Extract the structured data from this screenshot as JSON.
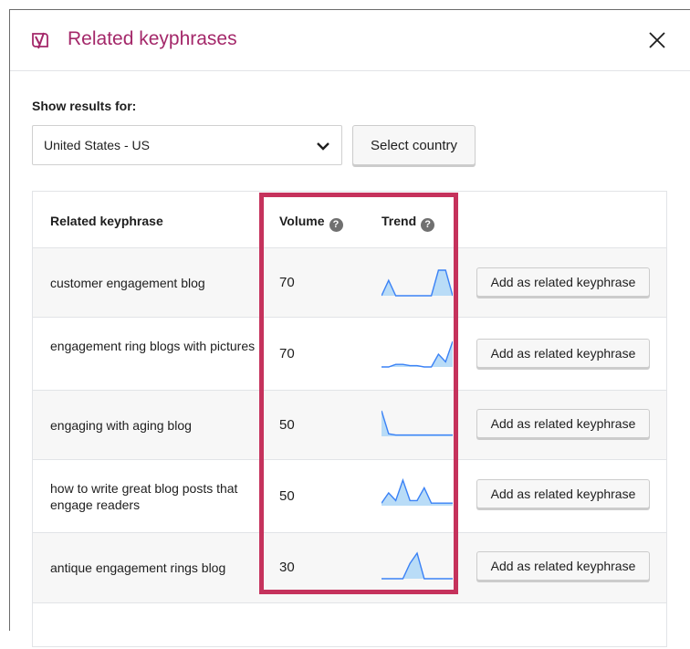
{
  "modal": {
    "title": "Related keyphrases",
    "logo_icon": "yoast-logo-icon",
    "close_icon": "close-icon",
    "title_color": "#a4286a"
  },
  "filter": {
    "label": "Show results for:",
    "country_value": "United States - US",
    "select_country_label": "Select country"
  },
  "table": {
    "headers": {
      "keyphrase": "Related keyphrase",
      "volume": "Volume",
      "trend": "Trend",
      "help_glyph": "?"
    },
    "rows": [
      {
        "keyphrase": "customer engagement blog",
        "volume": "70",
        "trend": [
          0,
          0.6,
          0,
          0,
          0,
          0,
          0,
          0,
          1,
          1,
          0
        ],
        "action": "Add as related keyphrase"
      },
      {
        "keyphrase": "engagement ring blogs with pictures",
        "volume": "70",
        "trend": [
          0,
          0,
          0.1,
          0.1,
          0.05,
          0.05,
          0,
          0,
          0.5,
          0.2,
          1
        ],
        "action": "Add as related keyphrase"
      },
      {
        "keyphrase": "engaging with aging blog",
        "volume": "50",
        "trend": [
          1,
          0.1,
          0.05,
          0.05,
          0.05,
          0.05,
          0.05,
          0.05,
          0.05,
          0.05,
          0.05
        ],
        "action": "Add as related keyphrase"
      },
      {
        "keyphrase": "how to write great blog posts that engage readers",
        "volume": "50",
        "trend": [
          0.1,
          0.5,
          0.2,
          1,
          0.2,
          0.2,
          0.7,
          0.1,
          0.1,
          0.1,
          0.1
        ],
        "action": "Add as related keyphrase"
      },
      {
        "keyphrase": "antique engagement rings blog",
        "volume": "30",
        "trend": [
          0,
          0,
          0,
          0,
          0.6,
          1,
          0,
          0,
          0,
          0,
          0
        ],
        "action": "Add as related keyphrase"
      }
    ]
  },
  "colors": {
    "trend_line": "#3b82f6",
    "trend_fill": "#b9dcf7",
    "highlight": "#c5325c"
  }
}
